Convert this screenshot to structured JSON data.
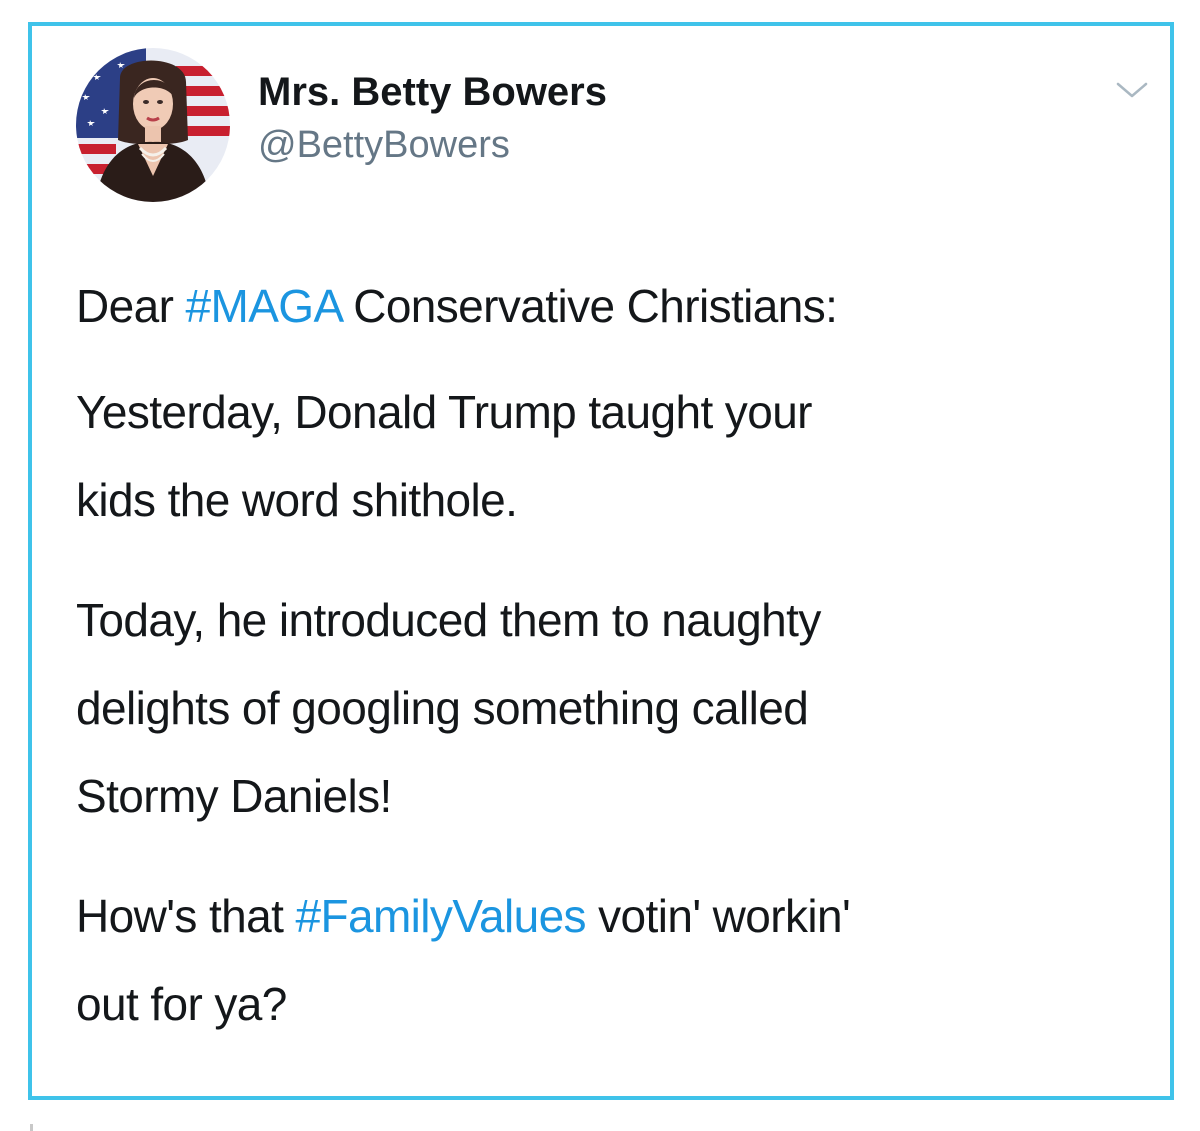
{
  "colors": {
    "frame_border": "#3fc3ea",
    "text": "#14171a",
    "secondary_text": "#657786",
    "hashtag": "#1b95e0"
  },
  "tweet": {
    "author": {
      "display_name": "Mrs. Betty Bowers",
      "handle": "@BettyBowers",
      "avatar_icon": "profile-photo-flag-background"
    },
    "menu_icon": "chevron-down-icon",
    "paragraphs": [
      {
        "lines": [
          {
            "before": "Dear ",
            "hashtag": "#MAGA",
            "after": " Conservative Christians:"
          }
        ]
      },
      {
        "lines": [
          {
            "text": "Yesterday, Donald Trump taught your"
          },
          {
            "text": "kids the word shithole."
          }
        ]
      },
      {
        "lines": [
          {
            "text": "Today, he introduced them to naughty"
          },
          {
            "text": "delights of googling something called"
          },
          {
            "text": "Stormy Daniels!"
          }
        ]
      },
      {
        "lines": [
          {
            "before": "How's that ",
            "hashtag": "#FamilyValues",
            "after": " votin' workin'"
          },
          {
            "text": "out for ya?"
          }
        ]
      }
    ]
  }
}
